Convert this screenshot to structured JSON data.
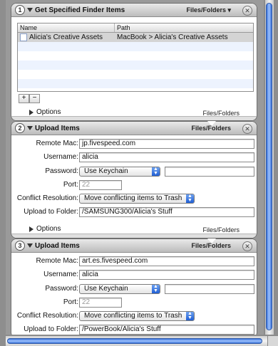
{
  "actions": [
    {
      "step": "1",
      "title": "Get Specified Finder Items",
      "type_label": "Files/Folders ▾",
      "table": {
        "columns": [
          "Name",
          "Path"
        ],
        "rows": [
          {
            "name": "Alicia's Creative Assets",
            "path": "MacBook > Alicia's Creative Assets"
          }
        ]
      },
      "add_label": "+",
      "remove_label": "−",
      "options_label": "Options",
      "output_type": "Files/Folders"
    },
    {
      "step": "2",
      "title": "Upload Items",
      "type_label": "Files/Folders",
      "fields": {
        "remote_mac_label": "Remote Mac:",
        "remote_mac_value": "jp.fivespeed.com",
        "username_label": "Username:",
        "username_value": "alicia",
        "password_label": "Password:",
        "password_popup": "Use Keychain",
        "port_label": "Port:",
        "port_placeholder": "22",
        "conflict_label": "Conflict Resolution:",
        "conflict_popup": "Move conflicting items to Trash",
        "upload_label": "Upload to Folder:",
        "upload_value": "/SAMSUNG300/Alicia's Stuff"
      },
      "options_label": "Options",
      "output_type": "Files/Folders"
    },
    {
      "step": "3",
      "title": "Upload Items",
      "type_label": "Files/Folders",
      "fields": {
        "remote_mac_label": "Remote Mac:",
        "remote_mac_value": "art.es.fivespeed.com",
        "username_label": "Username:",
        "username_value": "alicia",
        "password_label": "Password:",
        "password_popup": "Use Keychain",
        "port_label": "Port:",
        "port_placeholder": "22",
        "conflict_label": "Conflict Resolution:",
        "conflict_popup": "Move conflicting items to Trash",
        "upload_label": "Upload to Folder:",
        "upload_value": "/PowerBook/Alicia's Stuff"
      }
    }
  ],
  "colors": {
    "accent": "#1f5ed3",
    "canvas_bg": "#9a9a9a",
    "selection_row": "#d4d4d4",
    "alt_row": "#edf3fe"
  }
}
